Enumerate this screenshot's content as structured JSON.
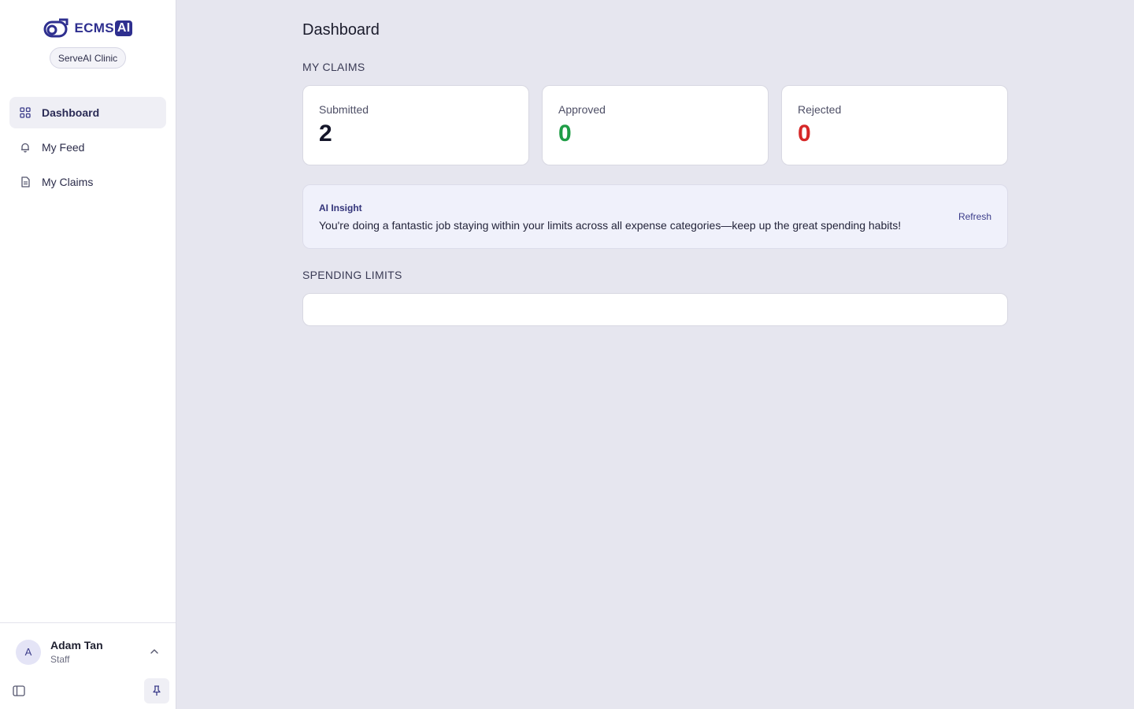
{
  "brand": {
    "name": "ECMS",
    "ai_suffix": "AI",
    "organization": "ServeAI Clinic"
  },
  "nav": [
    {
      "label": "Dashboard",
      "icon": "grid-icon",
      "active": true
    },
    {
      "label": "My Feed",
      "icon": "bell-icon",
      "active": false
    },
    {
      "label": "My Claims",
      "icon": "document-icon",
      "active": false
    }
  ],
  "user": {
    "initial": "A",
    "name": "Adam Tan",
    "role": "Staff"
  },
  "page": {
    "title": "Dashboard"
  },
  "claims": {
    "section_label": "MY CLAIMS",
    "stats": [
      {
        "label": "Submitted",
        "value": "2",
        "color": "#15162a"
      },
      {
        "label": "Approved",
        "value": "0",
        "color": "#1f9d46"
      },
      {
        "label": "Rejected",
        "value": "0",
        "color": "#d62828"
      }
    ]
  },
  "insight": {
    "title": "AI Insight",
    "text": "You're doing a fantastic job staying within your limits across all expense categories—keep up the great spending habits!",
    "refresh_label": "Refresh"
  },
  "spending_limits": {
    "section_label": "SPENDING LIMITS"
  },
  "colors": {
    "accent": "#2e2f8f",
    "background": "#e6e6ef",
    "approved": "#1f9d46",
    "rejected": "#d62828"
  }
}
